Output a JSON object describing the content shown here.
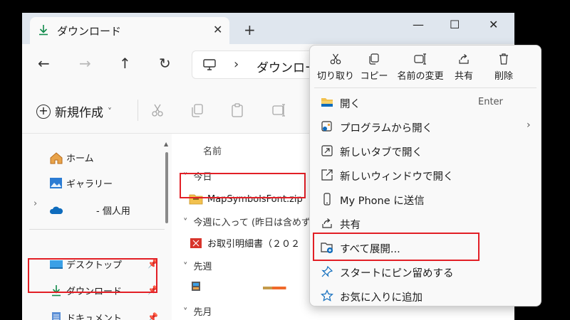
{
  "window": {
    "tab_title": "ダウンロード",
    "tab_close": "✕",
    "new_tab": "+",
    "minimize": "—",
    "maximize": "☐",
    "close": "✕"
  },
  "nav": {
    "back": "←",
    "forward": "→",
    "up": "↑",
    "refresh": "↻",
    "chevron": "›",
    "path": "ダウンロード"
  },
  "toolbar": {
    "new_label": "新規作成",
    "new_caret": "˅"
  },
  "sidebar": {
    "items": [
      {
        "label": "ホーム",
        "icon": "home-icon"
      },
      {
        "label": "ギャラリー",
        "icon": "gallery-icon"
      },
      {
        "label": "- 個人用",
        "icon": "onedrive-icon"
      },
      {
        "label": "デスクトップ",
        "icon": "desktop-icon"
      },
      {
        "label": "ダウンロード",
        "icon": "download-icon"
      },
      {
        "label": "ドキュメント",
        "icon": "document-icon"
      }
    ],
    "expander": "›",
    "pin": "📌"
  },
  "content": {
    "column_name": "名前",
    "groups": [
      {
        "label": "今日"
      },
      {
        "label": "今週に入って (昨日は含めず)"
      },
      {
        "label": "先週"
      },
      {
        "label": "先月"
      }
    ],
    "files": [
      {
        "name": "MapSymbolsFont.zip"
      },
      {
        "name": "お取引明細書（２０２"
      }
    ]
  },
  "context_menu": {
    "quick_actions": [
      {
        "label": "切り取り",
        "icon": "cut-icon"
      },
      {
        "label": "コピー",
        "icon": "copy-icon"
      },
      {
        "label": "名前の変更",
        "icon": "rename-icon"
      },
      {
        "label": "共有",
        "icon": "share-icon"
      },
      {
        "label": "削除",
        "icon": "delete-icon"
      }
    ],
    "items": [
      {
        "label": "開く",
        "shortcut": "Enter",
        "icon": "folder-open-icon"
      },
      {
        "label": "プログラムから開く",
        "arrow": "›",
        "icon": "open-with-icon"
      },
      {
        "label": "新しいタブで開く",
        "icon": "new-tab-icon"
      },
      {
        "label": "新しいウィンドウで開く",
        "icon": "new-window-icon"
      },
      {
        "label": "My Phone に送信",
        "icon": "phone-icon"
      },
      {
        "label": "共有",
        "icon": "share-icon"
      },
      {
        "label": "すべて展開...",
        "icon": "extract-all-icon"
      },
      {
        "label": "スタートにピン留めする",
        "icon": "pin-icon"
      },
      {
        "label": "お気に入りに追加",
        "icon": "star-icon"
      }
    ]
  },
  "colors": {
    "highlight": "#e21f26",
    "accent": "#0067c0"
  }
}
